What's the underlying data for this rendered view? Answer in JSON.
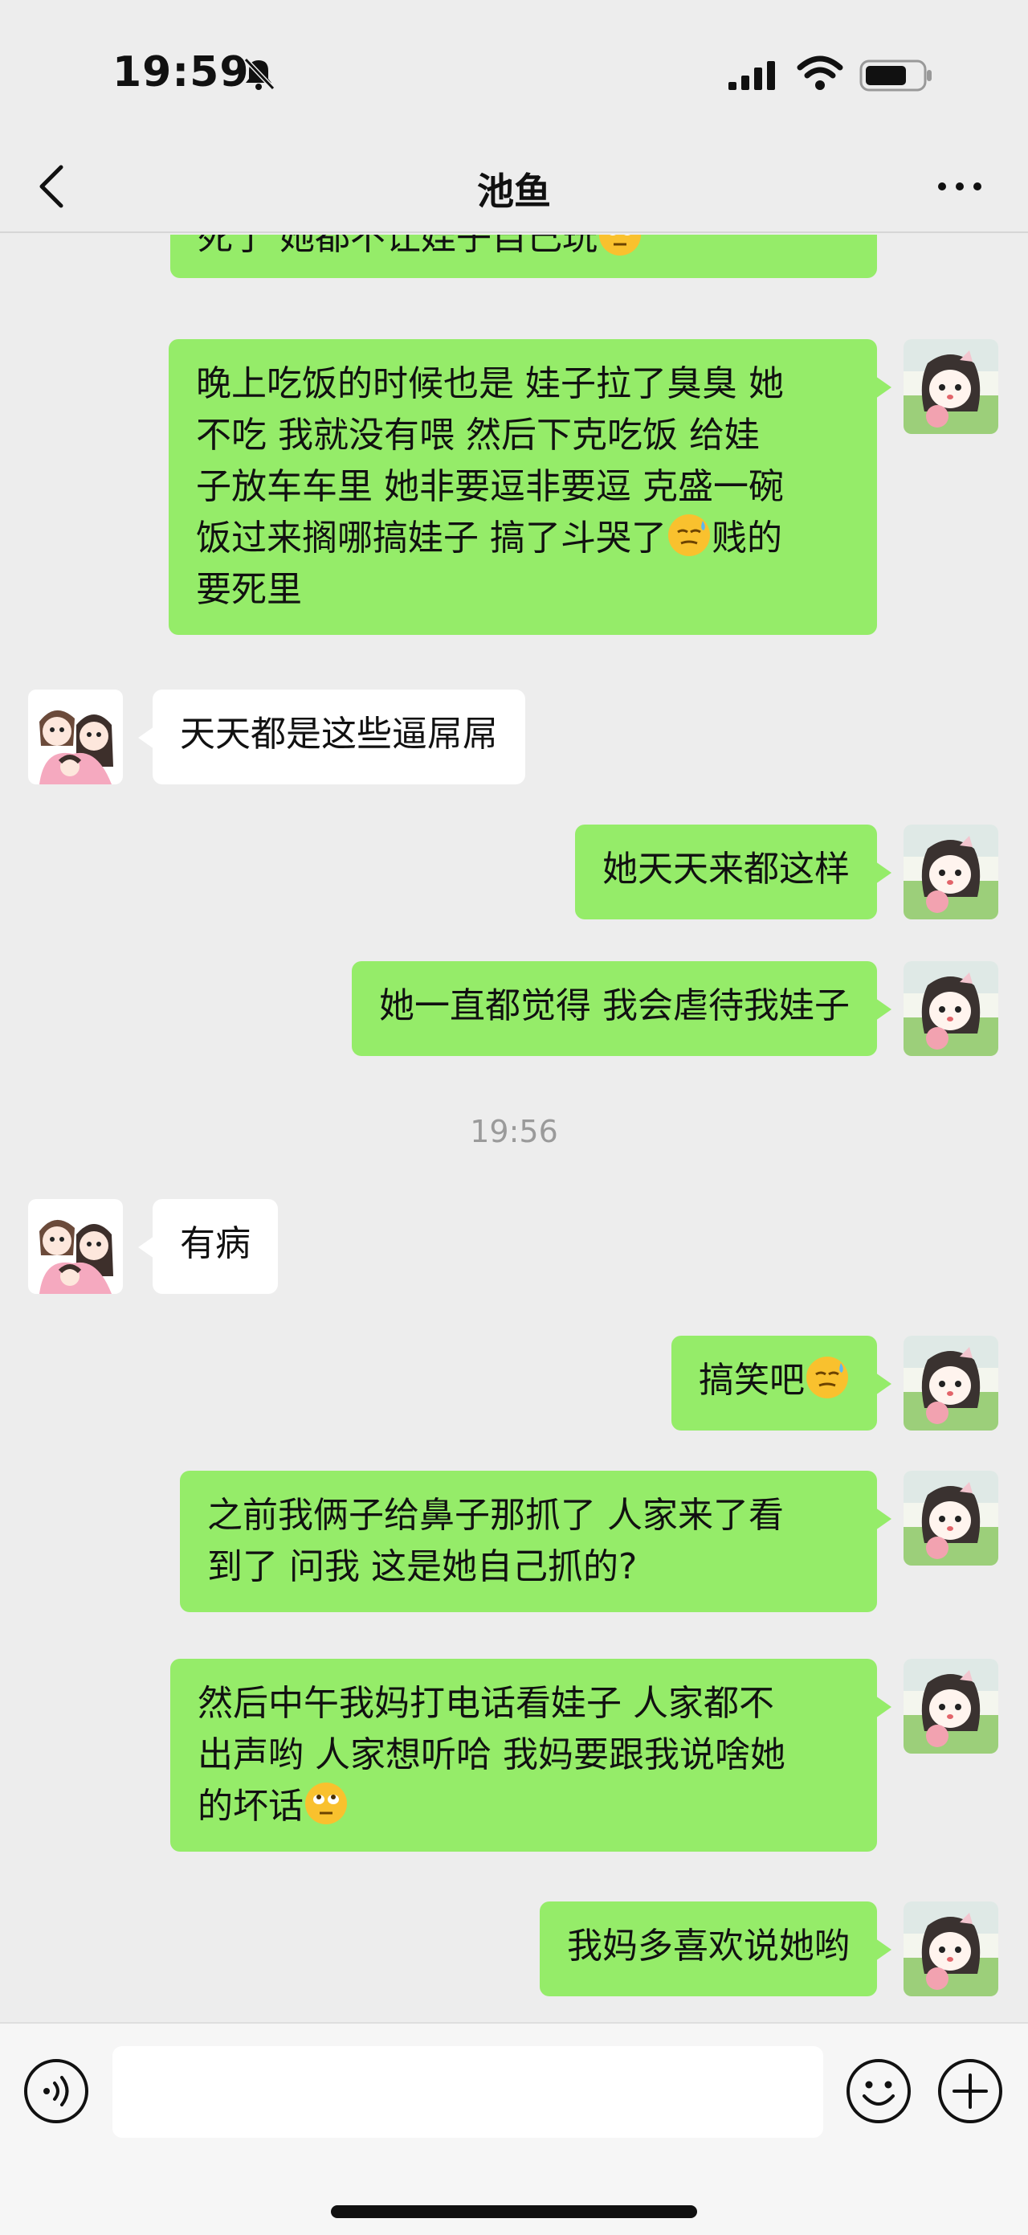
{
  "status_bar": {
    "time": "19:59",
    "icons": [
      "bell-muted-icon",
      "signal-icon",
      "wifi-icon",
      "battery-icon"
    ]
  },
  "header": {
    "title": "池鱼",
    "back_icon": "chevron-left-icon",
    "more_icon": "more-dots-icon"
  },
  "messages": [
    {
      "side": "out",
      "text": "死了 她都不让娃子自己玩",
      "emoji": "rolling-eyes-emoji",
      "partial": true
    },
    {
      "side": "out",
      "lines": [
        "晚上吃饭的时候也是 娃子拉了臭臭 她",
        "不吃 我就没有喂 然后下克吃饭 给娃",
        "子放车车里 她非要逗非要逗 克盛一碗"
      ],
      "line4_a": "饭过来搁哪搞娃子 搞了斗哭了",
      "emoji": "sweat-emoji",
      "line4_b": "贱的",
      "line5": "要死里"
    },
    {
      "side": "in",
      "text": "天天都是这些逼屌屌"
    },
    {
      "side": "out",
      "text": "她天天来都这样"
    },
    {
      "side": "out",
      "text": "她一直都觉得 我会虐待我娃子"
    },
    {
      "side": "in",
      "text": "有病"
    },
    {
      "side": "out",
      "text": "搞笑吧",
      "emoji": "sweat-emoji"
    },
    {
      "side": "out",
      "lines": [
        "之前我俩子给鼻子那抓了 人家来了看",
        "到了 问我 这是她自己抓的?"
      ]
    },
    {
      "side": "out",
      "lines": [
        "然后中午我妈打电话看娃子 人家都不",
        "出声哟 人家想听哈 我妈要跟我说啥她"
      ],
      "line3": "的坏话",
      "emoji": "rolling-eyes-emoji"
    },
    {
      "side": "out",
      "text": "我妈多喜欢说她哟"
    }
  ],
  "timestamp": "19:56",
  "input_bar": {
    "placeholder": "",
    "value": "",
    "voice_icon": "voice-icon",
    "emoji_icon": "emoji-face-icon",
    "plus_icon": "plus-icon"
  },
  "colors": {
    "background": "#ededed",
    "outgoing_bubble": "#95ec69",
    "incoming_bubble": "#ffffff",
    "timestamp": "#9a9a9a"
  }
}
